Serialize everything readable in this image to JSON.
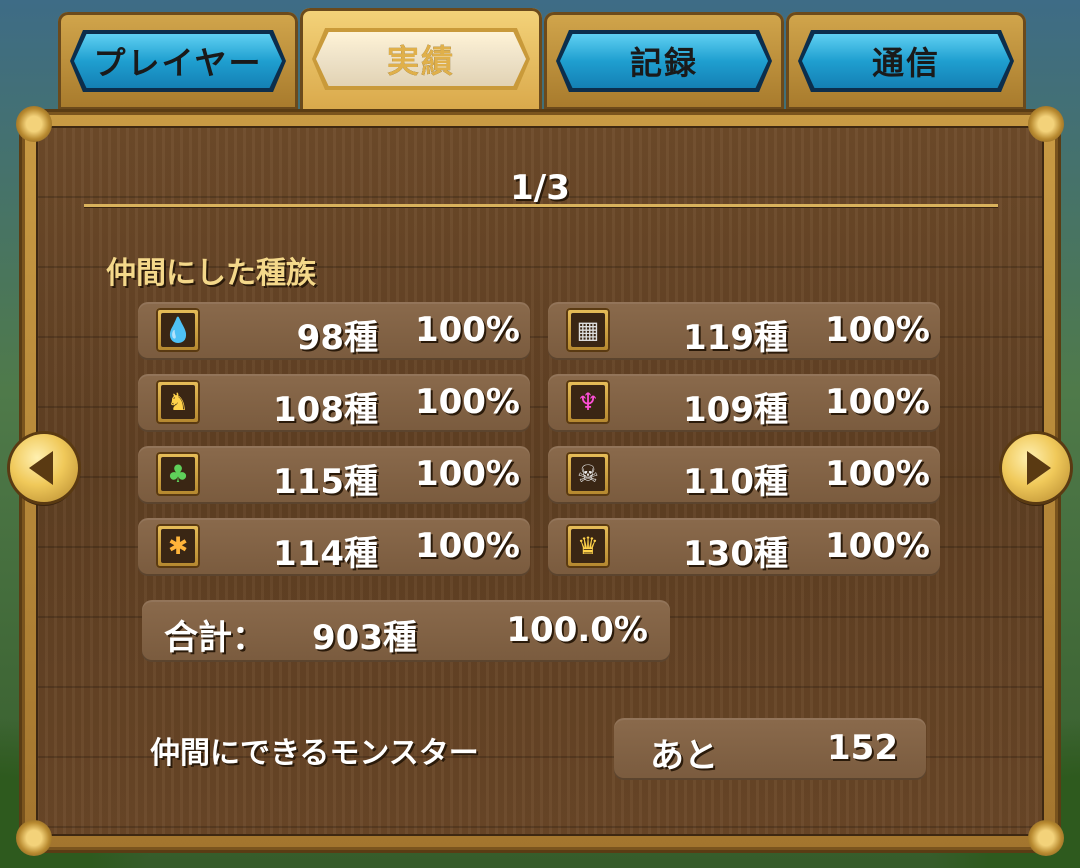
{
  "tabs": [
    {
      "label": "プレイヤー"
    },
    {
      "label": "実績"
    },
    {
      "label": "記録"
    },
    {
      "label": "通信"
    }
  ],
  "active_tab": "実績",
  "page_indicator": "1/3",
  "section_title": "仲間にした種族",
  "families": [
    {
      "icon": "slime-icon",
      "count": "98種",
      "percent": "100%"
    },
    {
      "icon": "material-icon",
      "count": "119種",
      "percent": "100%"
    },
    {
      "icon": "dragon-icon",
      "count": "108種",
      "percent": "100%"
    },
    {
      "icon": "demon-icon",
      "count": "109種",
      "percent": "100%"
    },
    {
      "icon": "plant-icon",
      "count": "115種",
      "percent": "100%"
    },
    {
      "icon": "zombie-icon",
      "count": "110種",
      "percent": "100%"
    },
    {
      "icon": "beast-icon",
      "count": "114種",
      "percent": "100%"
    },
    {
      "icon": "boss-crown-icon",
      "count": "130種",
      "percent": "100%"
    }
  ],
  "total": {
    "label": "合計：",
    "count": "903種",
    "percent": "100.0%"
  },
  "remaining": {
    "label": "仲間にできるモンスター",
    "prefix": "あと",
    "value": "152"
  },
  "colors": {
    "tab_blue": "#1f9fd0",
    "frame_gold": "#c99b44",
    "wood": "#6e4b2a",
    "title_gold": "#f4d88a"
  }
}
